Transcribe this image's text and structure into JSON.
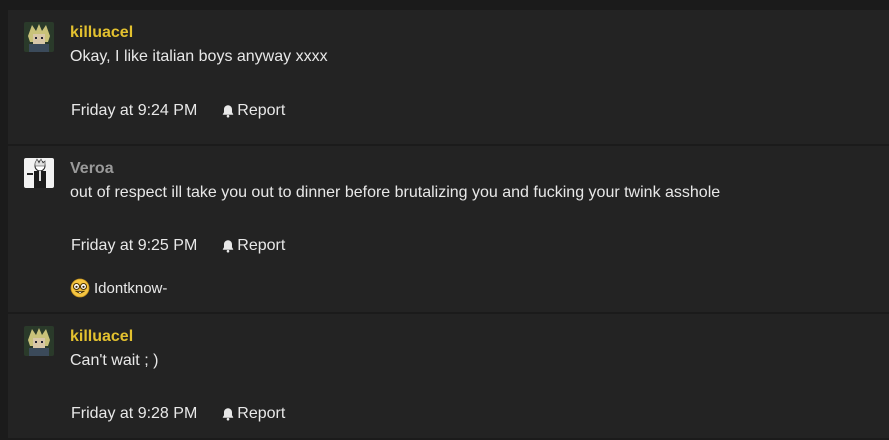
{
  "posts": [
    {
      "username": "killuacel",
      "message": "Okay, I like italian boys anyway xxxx",
      "timestamp": "Friday at 9:24 PM",
      "report_label": "Report"
    },
    {
      "username": "Veroa",
      "message": "out of respect ill take you out to dinner before brutalizing you and fucking your twink asshole",
      "timestamp": "Friday at 9:25 PM",
      "report_label": "Report",
      "reaction": {
        "icon": "nerd-emoji-icon",
        "user": "Idontknow-"
      }
    },
    {
      "username": "killuacel",
      "message": "Can't wait ; )",
      "timestamp": "Friday at 9:28 PM",
      "report_label": "Report"
    }
  ],
  "colors": {
    "background": "#1b1b1b",
    "post_background": "#232323",
    "highlight_username": "#e3c12f",
    "muted_username": "#9a9a9a",
    "text": "#e8e8e8"
  }
}
